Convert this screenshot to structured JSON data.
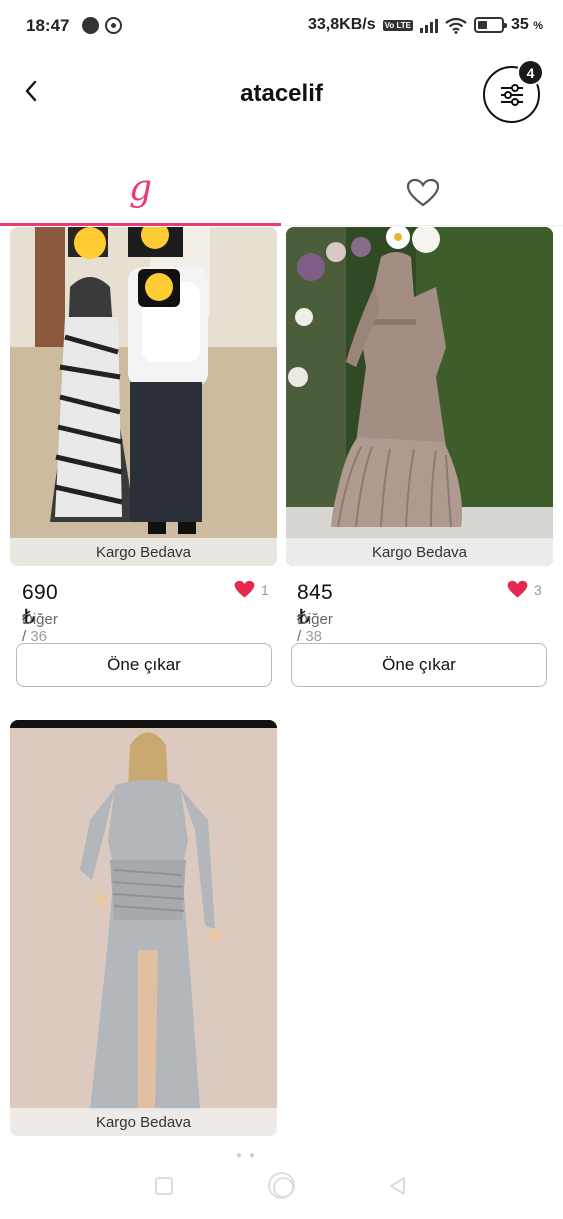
{
  "status_bar": {
    "time": "18:47",
    "net_speed": "33,8KB/s",
    "volte": "Vo LTE",
    "battery": "35",
    "battery_unit": "%",
    "icons": [
      "message-icon",
      "whatsapp-icon",
      "volte-icon",
      "signal-icon",
      "wifi-icon",
      "battery-icon"
    ]
  },
  "header": {
    "title": "atacelif",
    "filter_badge": "4",
    "icons": [
      "back-arrow-icon",
      "filter-sliders-icon"
    ]
  },
  "tabs": [
    {
      "icon": "g-logo-icon",
      "label": "g",
      "active": true
    },
    {
      "icon": "heart-outline-icon",
      "active": false
    }
  ],
  "accent_color": "#ea3a6f",
  "products": [
    {
      "badge": "Kargo Bedava",
      "price": "690 ₺",
      "likes": "1",
      "category": "Diğer",
      "separator": " / ",
      "size": "36",
      "action": "Öne çıkar"
    },
    {
      "badge": "Kargo Bedava",
      "price": "845 ₺",
      "likes": "3",
      "category": "Diğer",
      "separator": " / ",
      "size": "38",
      "action": "Öne çıkar"
    },
    {
      "badge": "Kargo Bedava"
    }
  ],
  "nav_bar": {
    "icons": [
      "recent-apps-icon",
      "home-icon",
      "back-icon"
    ]
  }
}
